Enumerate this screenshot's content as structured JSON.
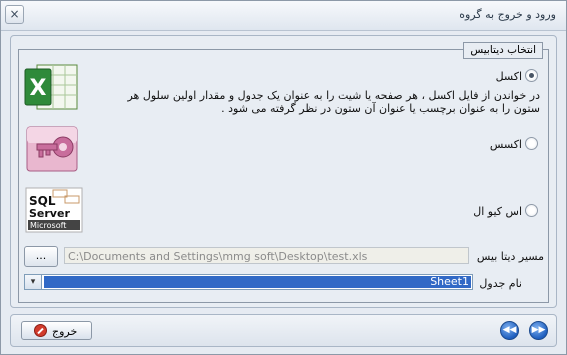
{
  "window": {
    "title": "ورود و خروج به گروه",
    "close_label": "×"
  },
  "group": {
    "title": "انتخاب دیتابیس"
  },
  "options": [
    {
      "label": "اکسل",
      "checked": true,
      "icon": "excel-icon"
    },
    {
      "label": "اکسس",
      "checked": false,
      "icon": "access-icon"
    },
    {
      "label": "اس کیو ال",
      "checked": false,
      "icon": "sql-server-icon"
    }
  ],
  "description": "در خواندن از فایل اکسل ، هر صفحه یا شیت را به عنوان یک جدول و مقدار اولین سلول هر ستون را به عنوان برچسب یا عنوان آن ستون در نظر گرفته می شود .",
  "sql_logo": {
    "line1": "SQL",
    "line2": "Server",
    "line3": "Microsoft"
  },
  "excel_logo": {
    "letter": "X"
  },
  "path": {
    "label": "مسیر دیتا بیس",
    "value": "C:\\Documents and Settings\\mmg soft\\Desktop\\test.xls",
    "browse_label": "..."
  },
  "table": {
    "label": "نام جدول",
    "value": "Sheet1"
  },
  "footer": {
    "exit_label": "خروج",
    "prev_symbol": "◀◀",
    "next_symbol": "▶▶"
  },
  "colors": {
    "selection": "#3169c6",
    "accent_blue": "#1f5fbf",
    "exit_red": "#d13b2c"
  }
}
